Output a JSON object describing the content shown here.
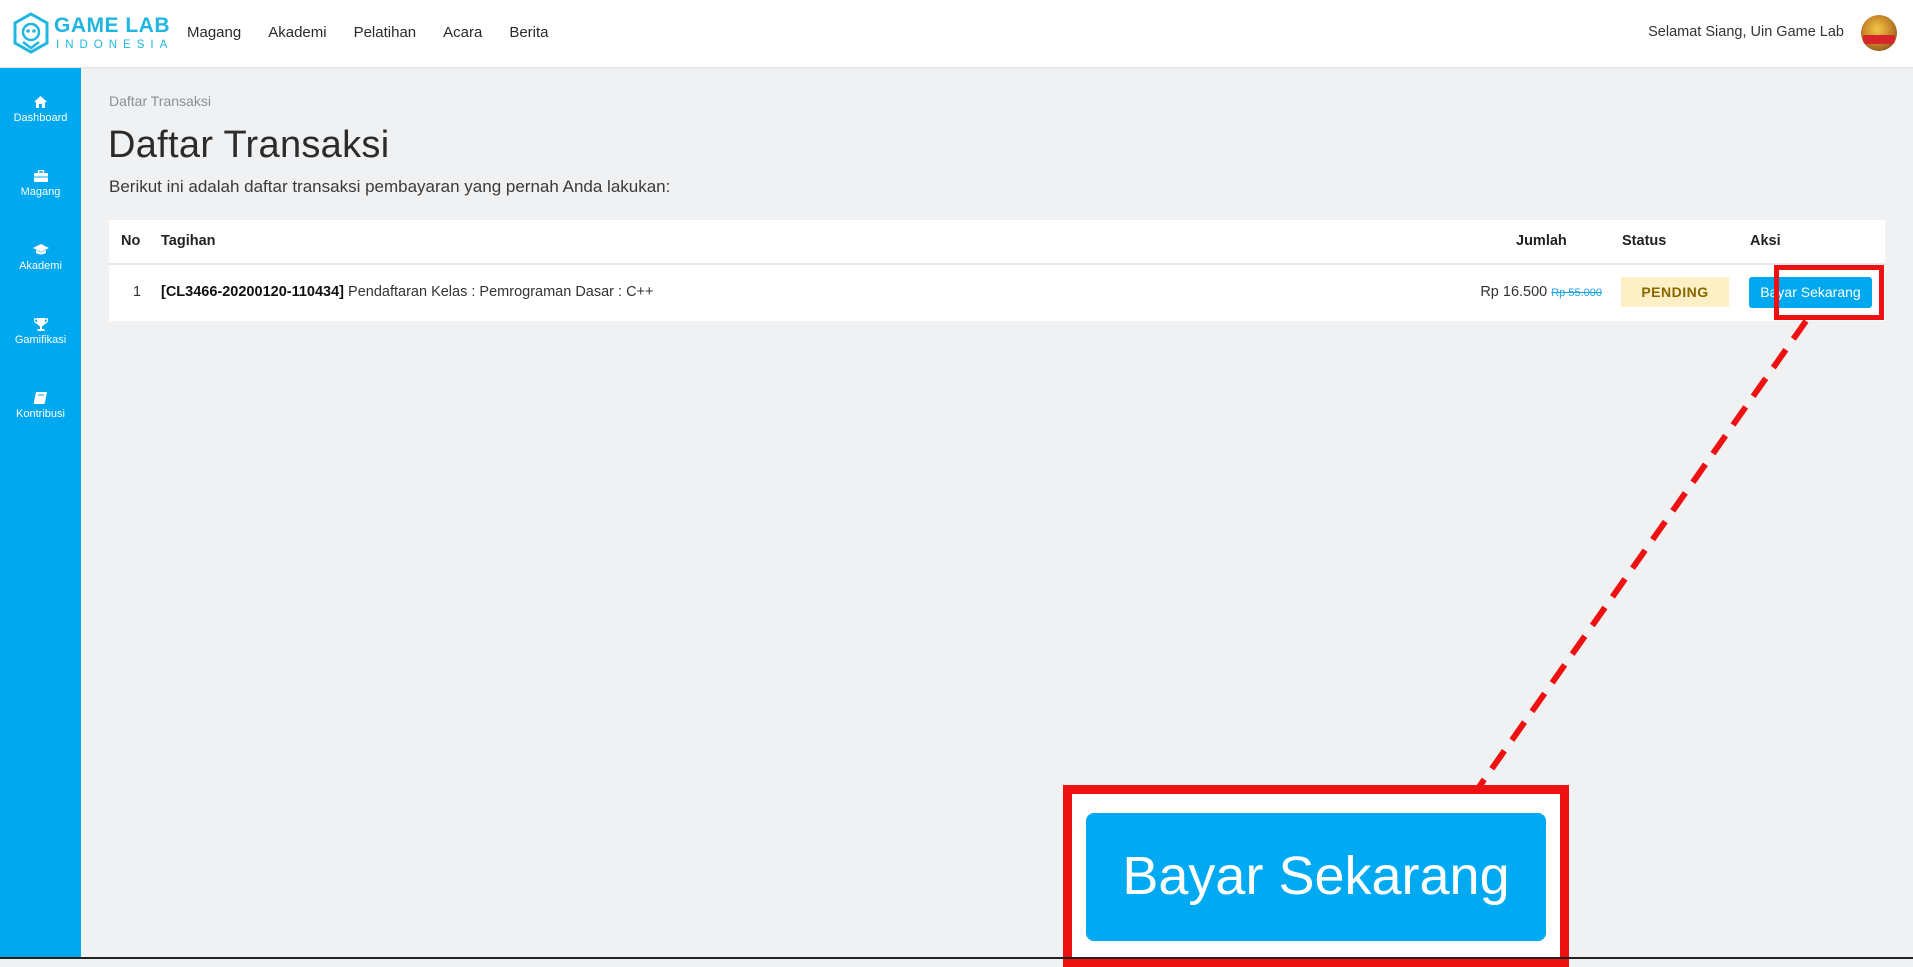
{
  "navbar": {
    "logo_main": "GAME LAB",
    "logo_sub": "INDONESIA",
    "links": [
      "Magang",
      "Akademi",
      "Pelatihan",
      "Acara",
      "Berita"
    ],
    "greeting": "Selamat Siang, Uin Game Lab"
  },
  "sidebar": {
    "items": [
      {
        "label": "Dashboard",
        "icon": "home-icon"
      },
      {
        "label": "Magang",
        "icon": "briefcase-icon"
      },
      {
        "label": "Akademi",
        "icon": "graduation-cap-icon"
      },
      {
        "label": "Gamifikasi",
        "icon": "trophy-icon"
      },
      {
        "label": "Kontribusi",
        "icon": "book-icon"
      }
    ]
  },
  "main": {
    "breadcrumb": "Daftar Transaksi",
    "title": "Daftar Transaksi",
    "description": "Berikut ini adalah daftar transaksi pembayaran yang pernah Anda lakukan:",
    "table": {
      "headers": {
        "no": "No",
        "tagihan": "Tagihan",
        "jumlah": "Jumlah",
        "status": "Status",
        "aksi": "Aksi"
      },
      "rows": [
        {
          "no": "1",
          "code": "[CL3466-20200120-110434]",
          "description": "Pendaftaran Kelas : Pemrograman Dasar : C++",
          "amount": "Rp 16.500",
          "original_amount": "Rp 55.000",
          "status": "PENDING",
          "action": "Bayar Sekarang"
        }
      ]
    }
  },
  "callout": {
    "zoom_label": "Bayar Sekarang",
    "highlight_color": "#ee1111"
  },
  "colors": {
    "brand": "#1fb6e0",
    "sidebar": "#00a8f0",
    "button": "#00a8f0",
    "pending_bg": "#fdf0c6"
  }
}
